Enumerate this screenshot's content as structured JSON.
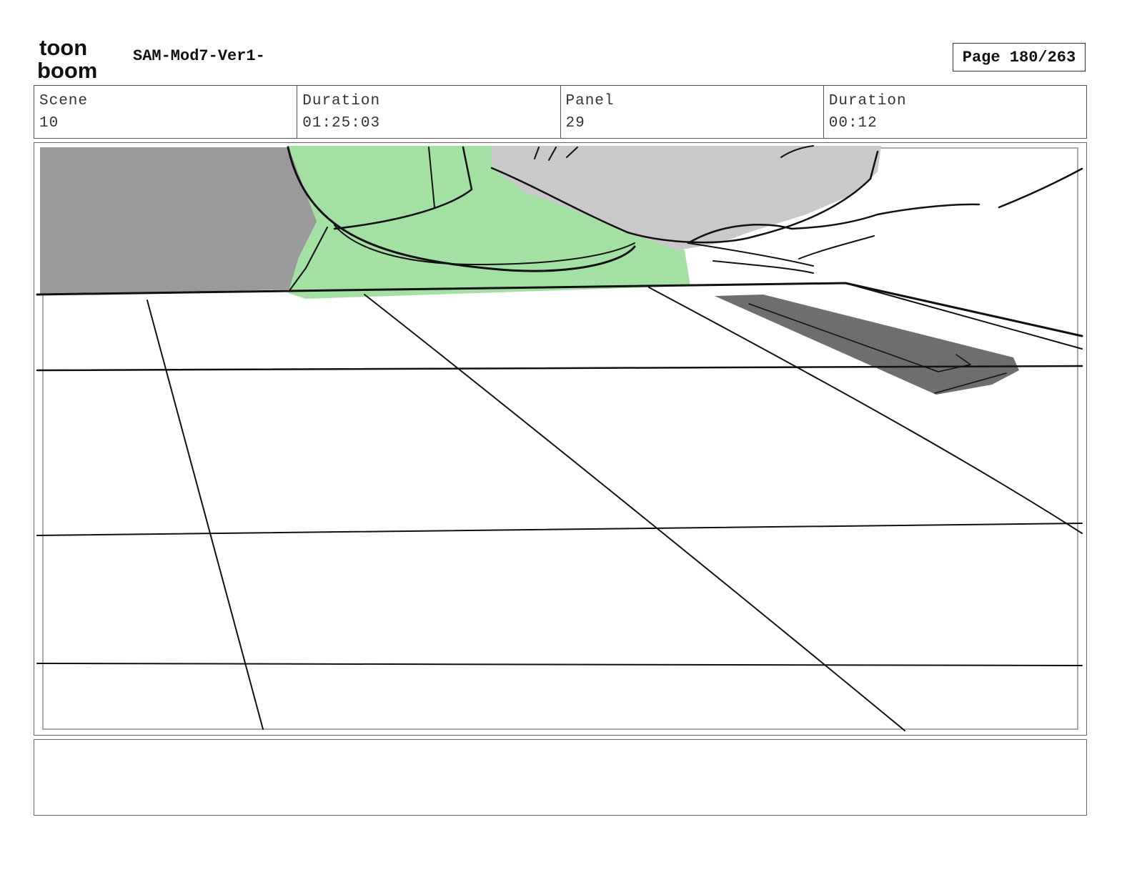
{
  "header": {
    "logo": {
      "top_text": "toon",
      "bottom_text": "boom",
      "icon": "toon-boom-logo-icon"
    },
    "project_title": "SAM-Mod7-Ver1-",
    "page_label": "Page 180/263"
  },
  "info": {
    "scene_label": "Scene",
    "scene_value": "10",
    "scene_duration_label": "Duration",
    "scene_duration_value": "01:25:03",
    "panel_label": "Panel",
    "panel_value": "29",
    "panel_duration_label": "Duration",
    "panel_duration_value": "00:12"
  },
  "panel": {
    "icon": "storyboard-sketch-floor-tiles",
    "colors": {
      "wall": "#9a9a9a",
      "green": "#a4e0a4",
      "gray_shape": "#c9c9c9",
      "vent": "#6e6e6e"
    }
  },
  "notes": {
    "text": ""
  }
}
